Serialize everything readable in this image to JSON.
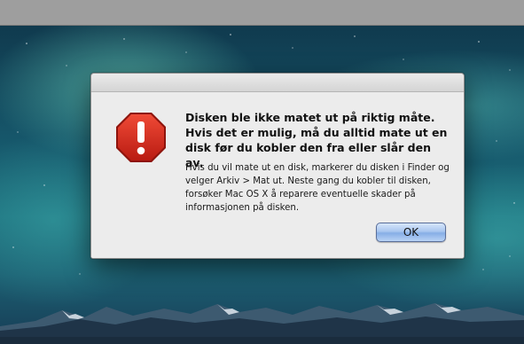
{
  "dialog": {
    "headline": "Disken ble ikke matet ut på riktig måte. Hvis det er mulig, må du alltid mate ut en disk før du kobler den fra eller slår den av.",
    "details": "Hvis du vil mate ut en disk, markerer du disken i Finder og velger Arkiv > Mat ut. Neste gang du kobler til disken, forsøker Mac OS X å reparere eventuelle skader på informasjonen på disken.",
    "ok_label": "OK",
    "icon": "stop-exclamation-icon"
  },
  "colors": {
    "stop_icon": "#d3261b",
    "ok_button": "#a9c6ef",
    "dialog_bg": "#ececec"
  }
}
